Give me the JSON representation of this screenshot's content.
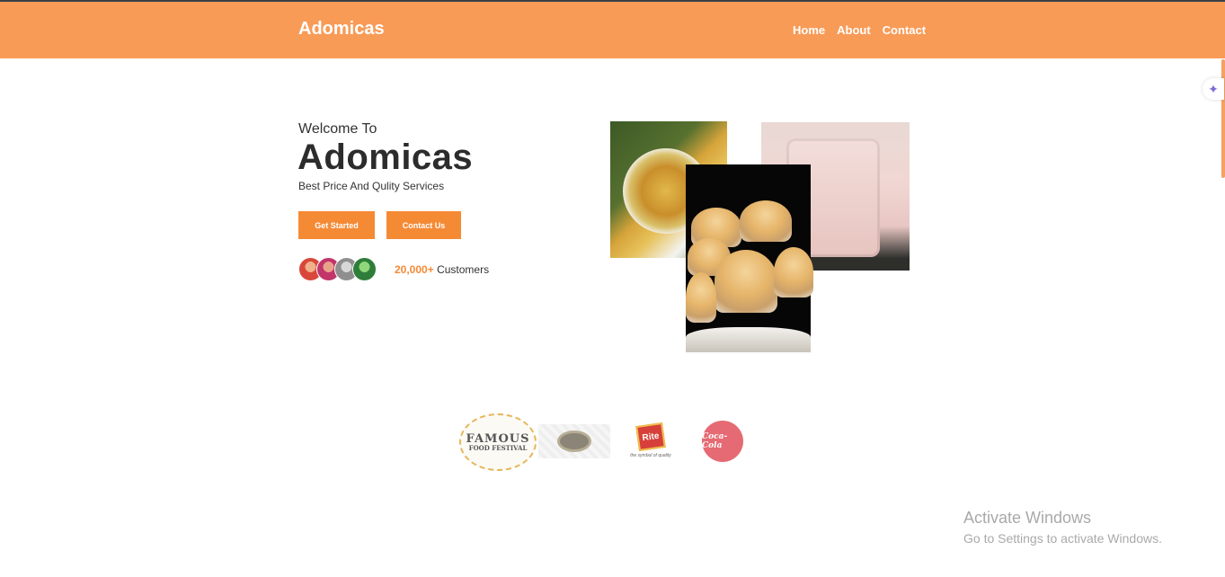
{
  "header": {
    "brand": "Adomicas",
    "nav": [
      {
        "label": "Home"
      },
      {
        "label": "About"
      },
      {
        "label": "Contact"
      }
    ]
  },
  "hero": {
    "welcome": "Welcome To",
    "title": "Adomicas",
    "tagline": "Best Price And Qulity Services",
    "primary_button": "Get Started",
    "secondary_button": "Contact Us",
    "customer_count": "20,000+",
    "customer_label": "Customers",
    "avatar_colors": [
      "#d9473b",
      "#c2356b",
      "#8f8f8f",
      "#2f7d3a"
    ]
  },
  "gallery": [
    "rice-dish-photo",
    "muffins-photo",
    "cake-photo"
  ],
  "partners": {
    "famous_line1": "FAMOUS",
    "famous_line2": "FOOD FESTIVAL",
    "rite_label": "Rite",
    "rite_tagline": "the symbol of quality",
    "coke_label": "Coca-Cola"
  },
  "watermark": {
    "title": "Activate Windows",
    "subtitle": "Go to Settings to activate Windows."
  },
  "colors": {
    "header_bg": "#f89b57",
    "accent": "#f58a35"
  }
}
